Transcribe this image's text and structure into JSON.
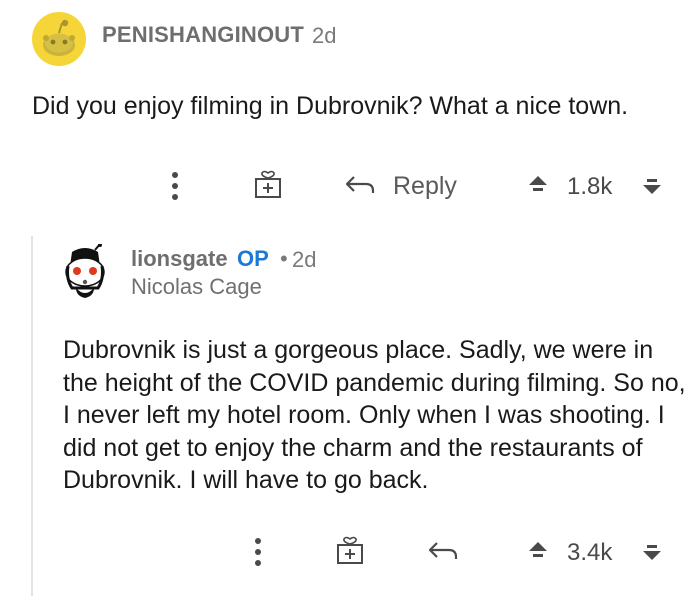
{
  "parent_comment": {
    "author": "PENISHANGINOUT",
    "time": "2d",
    "body": "Did you enjoy filming in Dubrovnik? What a nice town.",
    "actions": {
      "reply_label": "Reply",
      "score": "1.8k"
    }
  },
  "reply_comment": {
    "author": "lionsgate",
    "op_badge": "OP",
    "separator": "•",
    "time": "2d",
    "flair": "Nicolas Cage",
    "body": "Dubrovnik is just a gorgeous place. Sadly, we were in the height of the COVID pandemic during filming. So no, I never left my hotel room. Only when I was shooting. I did not get to enjoy the charm and the restaurants of Dubrovnik. I will have to go back.",
    "actions": {
      "score": "3.4k"
    }
  },
  "colors": {
    "avatar_yellow": "#f5d538",
    "op_blue": "#1d79d6",
    "thread_line": "#e3e3e3"
  },
  "icons": [
    "more-icon",
    "gift-icon",
    "reply-icon",
    "upvote-icon",
    "downvote-icon"
  ]
}
